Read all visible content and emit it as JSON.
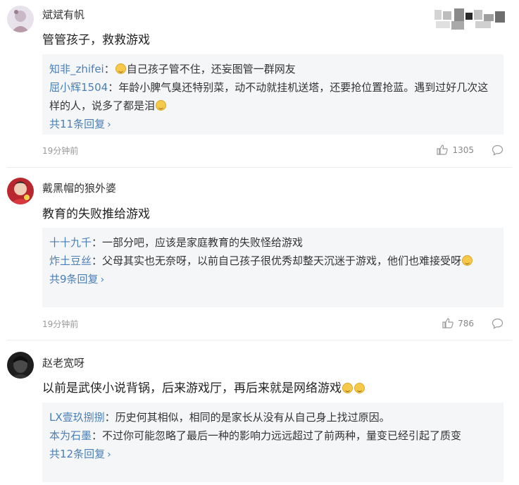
{
  "comments": [
    {
      "username": "斌斌有帆",
      "text": "管管孩子，救救游戏",
      "replies": [
        {
          "user": "知非_zhifei",
          "sep": "：",
          "pre_emoji": true,
          "text": "自己孩子管不住，还妄图管一群网友",
          "post_emoji": false
        },
        {
          "user": "屈小辉1504",
          "sep": "：",
          "pre_emoji": false,
          "text": "年龄小脾气臭还特别菜，动不动就挂机送塔，还要抢位置抢蓝。遇到过好几次这样的人，说多了都是泪",
          "post_emoji": true
        }
      ],
      "more_replies": "共11条回复",
      "time": "19分钟前",
      "likes": "1305"
    },
    {
      "username": "戴黑帽的狼外婆",
      "text": "教育的失败推给游戏",
      "replies": [
        {
          "user": "十十九千",
          "sep": "：",
          "pre_emoji": false,
          "text": "一部分吧，应该是家庭教育的失败怪给游戏",
          "post_emoji": false
        },
        {
          "user": "炸土豆丝",
          "sep": "：",
          "pre_emoji": false,
          "text": "父母其实也无奈呀，以前自己孩子很优秀却整天沉迷于游戏，他们也难接受呀",
          "post_emoji": true
        }
      ],
      "more_replies": "共9条回复",
      "time": "19分钟前",
      "likes": "786"
    },
    {
      "username": "赵老宽呀",
      "text": "以前是武侠小说背锅，后来游戏厅，再后来就是网络游戏",
      "replies": [
        {
          "user": "LX壹玖捌捌",
          "sep": "：",
          "pre_emoji": false,
          "text": "历史何其相似，相同的是家长从没有从自己身上找过原因。",
          "post_emoji": false
        },
        {
          "user": "本为石墨",
          "sep": "：",
          "pre_emoji": false,
          "text": "不过你可能忽略了最后一种的影响力远远超过了前两种，量变已经引起了质变",
          "post_emoji": false
        }
      ],
      "more_replies": "共12条回复"
    }
  ],
  "icons": {
    "like": "thumbs-up-icon",
    "reply": "comment-bubble-icon",
    "chevron": "chevron-right-icon",
    "emoji": "smiley-emoji-icon"
  },
  "colors": {
    "username_link": "#4a7fb5",
    "reply_bg": "#f5f6f8",
    "meta": "#999999"
  }
}
